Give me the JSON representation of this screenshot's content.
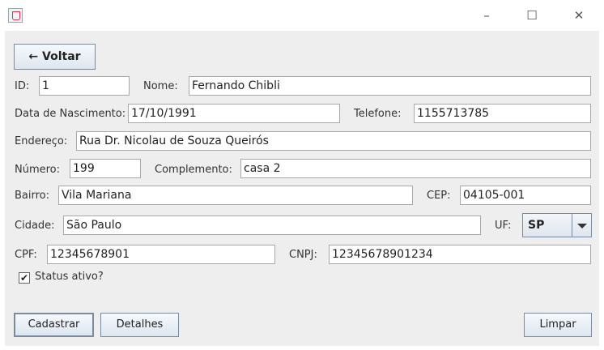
{
  "window": {
    "title": ""
  },
  "back_button": {
    "label": "← Voltar"
  },
  "form": {
    "id": {
      "label": "ID:",
      "value": "1"
    },
    "nome": {
      "label": "Nome:",
      "value": "Fernando Chibli"
    },
    "nascimento": {
      "label": "Data de Nascimento:",
      "value": "17/10/1991"
    },
    "telefone": {
      "label": "Telefone:",
      "value": "1155713785"
    },
    "endereco": {
      "label": "Endereço:",
      "value": "Rua Dr. Nicolau de Souza Queirós"
    },
    "numero": {
      "label": "Número:",
      "value": "199"
    },
    "complemento": {
      "label": "Complemento:",
      "value": "casa 2"
    },
    "bairro": {
      "label": "Bairro:",
      "value": "Vila Mariana"
    },
    "cep": {
      "label": "CEP:",
      "value": "04105-001"
    },
    "cidade": {
      "label": "Cidade:",
      "value": "São Paulo"
    },
    "uf": {
      "label": "UF:",
      "value": "SP"
    },
    "cpf": {
      "label": "CPF:",
      "value": "12345678901"
    },
    "cnpj": {
      "label": "CNPJ:",
      "value": "12345678901234"
    },
    "status": {
      "label": "Status ativo?",
      "checked": true,
      "mark": "✔"
    }
  },
  "actions": {
    "cadastrar": "Cadastrar",
    "detalhes": "Detalhes",
    "limpar": "Limpar"
  },
  "titlebar_icons": {
    "minimize": "–",
    "maximize": "☐",
    "close": "✕"
  }
}
